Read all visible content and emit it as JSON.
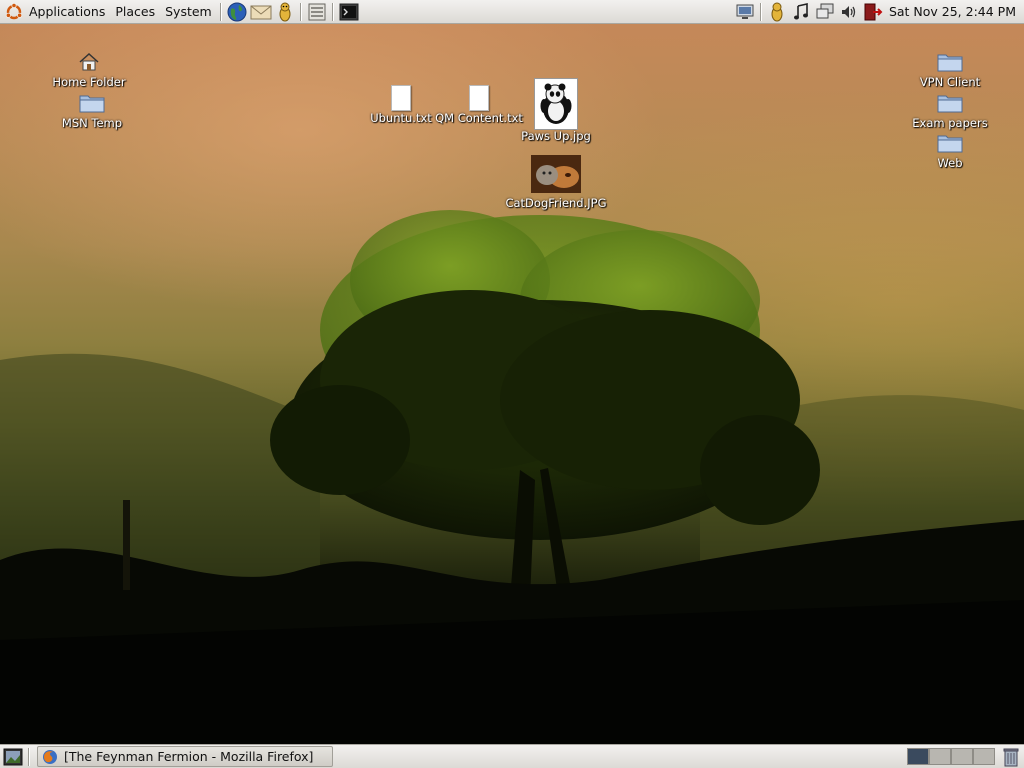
{
  "top_panel": {
    "menus": [
      "Applications",
      "Places",
      "System"
    ],
    "launchers": [
      "web-browser-icon",
      "email-icon",
      "messenger-icon",
      "text-editor-icon",
      "terminal-icon"
    ],
    "tray_icons": [
      "network-icon",
      "messenger-tray-icon",
      "music-icon",
      "display-icon",
      "volume-icon",
      "logout-icon"
    ],
    "clock": "Sat Nov 25,  2:44 PM"
  },
  "desktop_icons": {
    "home_folder": "Home Folder",
    "msn_temp": "MSN Temp",
    "ubuntu_txt": "Ubuntu.txt",
    "qm_content": "QM Content.txt",
    "paws_up": "Paws Up.jpg",
    "catdog": "CatDogFriend.JPG",
    "vpn_client": "VPN Client",
    "exam_papers": "Exam papers",
    "web": "Web"
  },
  "bottom_panel": {
    "task_title": "[The Feynman Fermion - Mozilla Firefox]",
    "workspaces": [
      {
        "active": true
      },
      {
        "active": false
      },
      {
        "active": false
      },
      {
        "active": false
      }
    ]
  },
  "colors": {
    "panel": "#dcdad5",
    "folder": "#a7bfdf",
    "active_workspace": "#3a4a5e"
  }
}
